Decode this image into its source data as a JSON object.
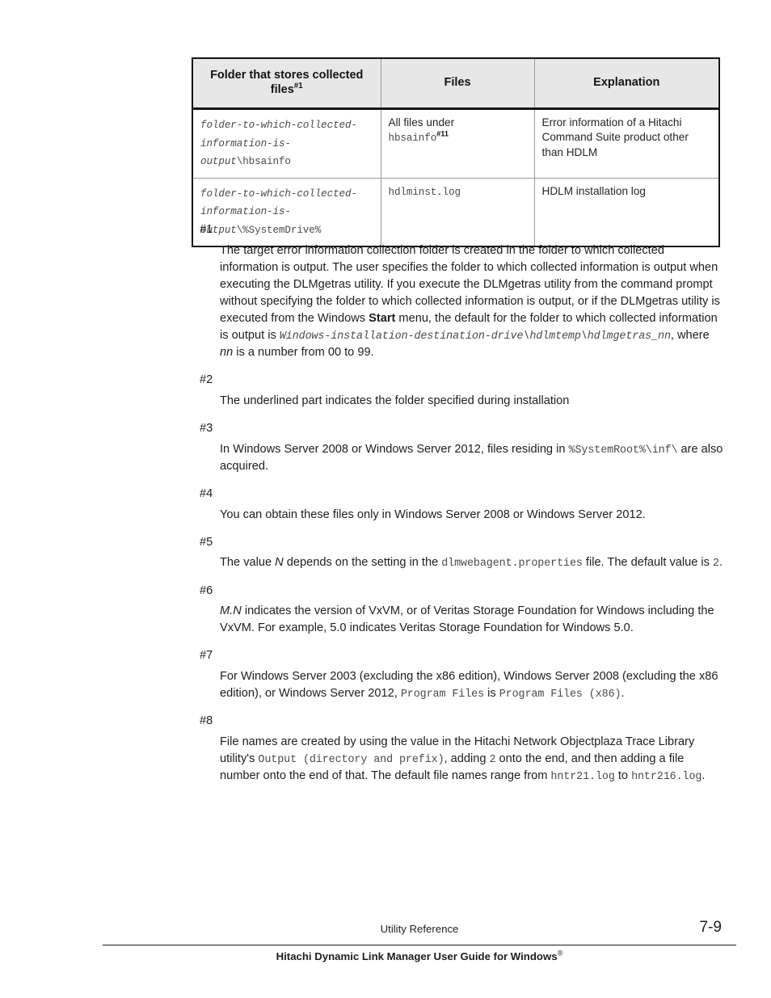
{
  "document": {
    "page_number": "7-9",
    "footer_section": "Utility Reference",
    "footer_title_main": "Hitachi Dynamic Link Manager User Guide for Windows",
    "footer_title_sup": "®"
  },
  "table": {
    "headers": [
      {
        "text": "Folder that stores collected files",
        "sup": "#1"
      },
      {
        "text": "Files",
        "sup": ""
      },
      {
        "text": "Explanation",
        "sup": ""
      }
    ],
    "rows": [
      {
        "folder_italic": "folder-to-which-collected-information-is-output",
        "folder_plain": "\\hbsainfo",
        "files_plain": "All files under",
        "files_mono": "hbsainfo",
        "files_sup": "#11",
        "explanation": "Error information of a Hitachi Command Suite product other than HDLM"
      },
      {
        "folder_italic": "folder-to-which-collected-information-is-output",
        "folder_plain": "\\%SystemDrive%",
        "files_plain": "",
        "files_mono": "hdlminst.log",
        "files_sup": "",
        "explanation": "HDLM installation log"
      }
    ]
  },
  "notes": [
    {
      "label": "#1",
      "parts": [
        {
          "type": "text",
          "value": "The target error information collection folder is created in the folder to which collected information is output. The user specifies the folder to which collected information is output when executing the DLMgetras utility. If you execute the DLMgetras utility from the command prompt without specifying the folder to which collected information is output, or if the DLMgetras utility is executed from the Windows "
        },
        {
          "type": "bold",
          "value": "Start"
        },
        {
          "type": "text",
          "value": " menu, the default for the folder to which collected information is output is "
        },
        {
          "type": "mono-italic",
          "value": "Windows-installation-destination-drive\\hdlmtemp\\hdlmgetras_nn"
        },
        {
          "type": "text",
          "value": ", where "
        },
        {
          "type": "italic",
          "value": "nn"
        },
        {
          "type": "text",
          "value": " is a number from 00 to 99."
        }
      ]
    },
    {
      "label": "#2",
      "parts": [
        {
          "type": "text",
          "value": "The underlined part indicates the folder specified during installation"
        }
      ]
    },
    {
      "label": "#3",
      "parts": [
        {
          "type": "text",
          "value": "In Windows Server 2008 or Windows Server 2012, files residing in "
        },
        {
          "type": "mono",
          "value": "%SystemRoot%\\inf\\"
        },
        {
          "type": "text",
          "value": " are also acquired."
        }
      ]
    },
    {
      "label": "#4",
      "parts": [
        {
          "type": "text",
          "value": "You can obtain these files only in Windows Server 2008 or Windows Server 2012."
        }
      ]
    },
    {
      "label": "#5",
      "parts": [
        {
          "type": "text",
          "value": "The value "
        },
        {
          "type": "italic",
          "value": "N"
        },
        {
          "type": "text",
          "value": " depends on the setting in the "
        },
        {
          "type": "mono",
          "value": "dlmwebagent.properties"
        },
        {
          "type": "text",
          "value": " file. The default value is "
        },
        {
          "type": "mono",
          "value": "2"
        },
        {
          "type": "text",
          "value": "."
        }
      ]
    },
    {
      "label": "#6",
      "parts": [
        {
          "type": "italic",
          "value": "M.N"
        },
        {
          "type": "text",
          "value": " indicates the version of VxVM, or of Veritas Storage Foundation for Windows including the VxVM. For example, 5.0 indicates Veritas Storage Foundation for Windows 5.0."
        }
      ]
    },
    {
      "label": "#7",
      "parts": [
        {
          "type": "text",
          "value": "For Windows Server 2003 (excluding the x86 edition), Windows Server 2008 (excluding the x86 edition), or Windows Server 2012, "
        },
        {
          "type": "mono",
          "value": "Program Files"
        },
        {
          "type": "text",
          "value": " is "
        },
        {
          "type": "mono",
          "value": "Program Files (x86)"
        },
        {
          "type": "text",
          "value": "."
        }
      ]
    },
    {
      "label": "#8",
      "parts": [
        {
          "type": "text",
          "value": "File names are created by using the value in the Hitachi Network Objectplaza Trace Library utility's "
        },
        {
          "type": "mono",
          "value": "Output (directory and prefix)"
        },
        {
          "type": "text",
          "value": ", adding "
        },
        {
          "type": "mono",
          "value": "2"
        },
        {
          "type": "text",
          "value": " onto the end, and then adding a file number onto the end of that. The default file names range from "
        },
        {
          "type": "mono",
          "value": "hntr21.log"
        },
        {
          "type": "text",
          "value": " to "
        },
        {
          "type": "mono",
          "value": "hntr216.log"
        },
        {
          "type": "text",
          "value": "."
        }
      ]
    }
  ]
}
